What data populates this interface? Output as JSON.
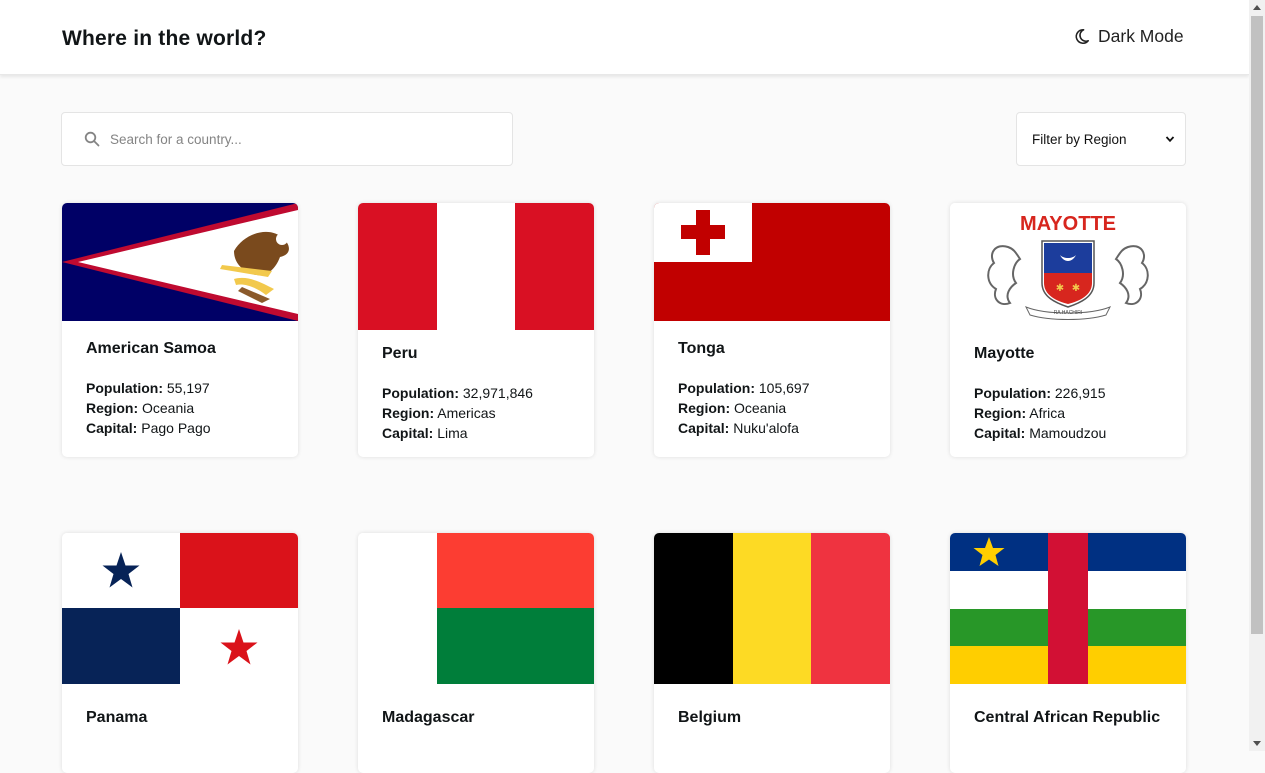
{
  "header": {
    "title": "Where in the world?",
    "mode_toggle_label": "Dark Mode",
    "mode_icon": "moon-icon"
  },
  "search": {
    "placeholder": "Search for a country...",
    "value": "",
    "icon": "search-icon"
  },
  "filter": {
    "label": "Filter by Region",
    "icon": "chevron-down-icon"
  },
  "labels": {
    "population": "Population:",
    "region": "Region:",
    "capital": "Capital:"
  },
  "countries": [
    {
      "name": "American Samoa",
      "population": "55,197",
      "region": "Oceania",
      "capital": "Pago Pago",
      "flag": "american-samoa-flag"
    },
    {
      "name": "Peru",
      "population": "32,971,846",
      "region": "Americas",
      "capital": "Lima",
      "flag": "peru-flag"
    },
    {
      "name": "Tonga",
      "population": "105,697",
      "region": "Oceania",
      "capital": "Nuku'alofa",
      "flag": "tonga-flag"
    },
    {
      "name": "Mayotte",
      "population": "226,915",
      "region": "Africa",
      "capital": "Mamoudzou",
      "flag": "mayotte-flag",
      "flag_text": "MAYOTTE",
      "flag_motto": "RA HACHIRI"
    },
    {
      "name": "Panama",
      "flag": "panama-flag"
    },
    {
      "name": "Madagascar",
      "flag": "madagascar-flag"
    },
    {
      "name": "Belgium",
      "flag": "belgium-flag"
    },
    {
      "name": "Central African Republic",
      "flag": "central-african-republic-flag"
    }
  ],
  "colors": {
    "background": "#fafafa",
    "card": "#ffffff",
    "text": "#111517"
  }
}
